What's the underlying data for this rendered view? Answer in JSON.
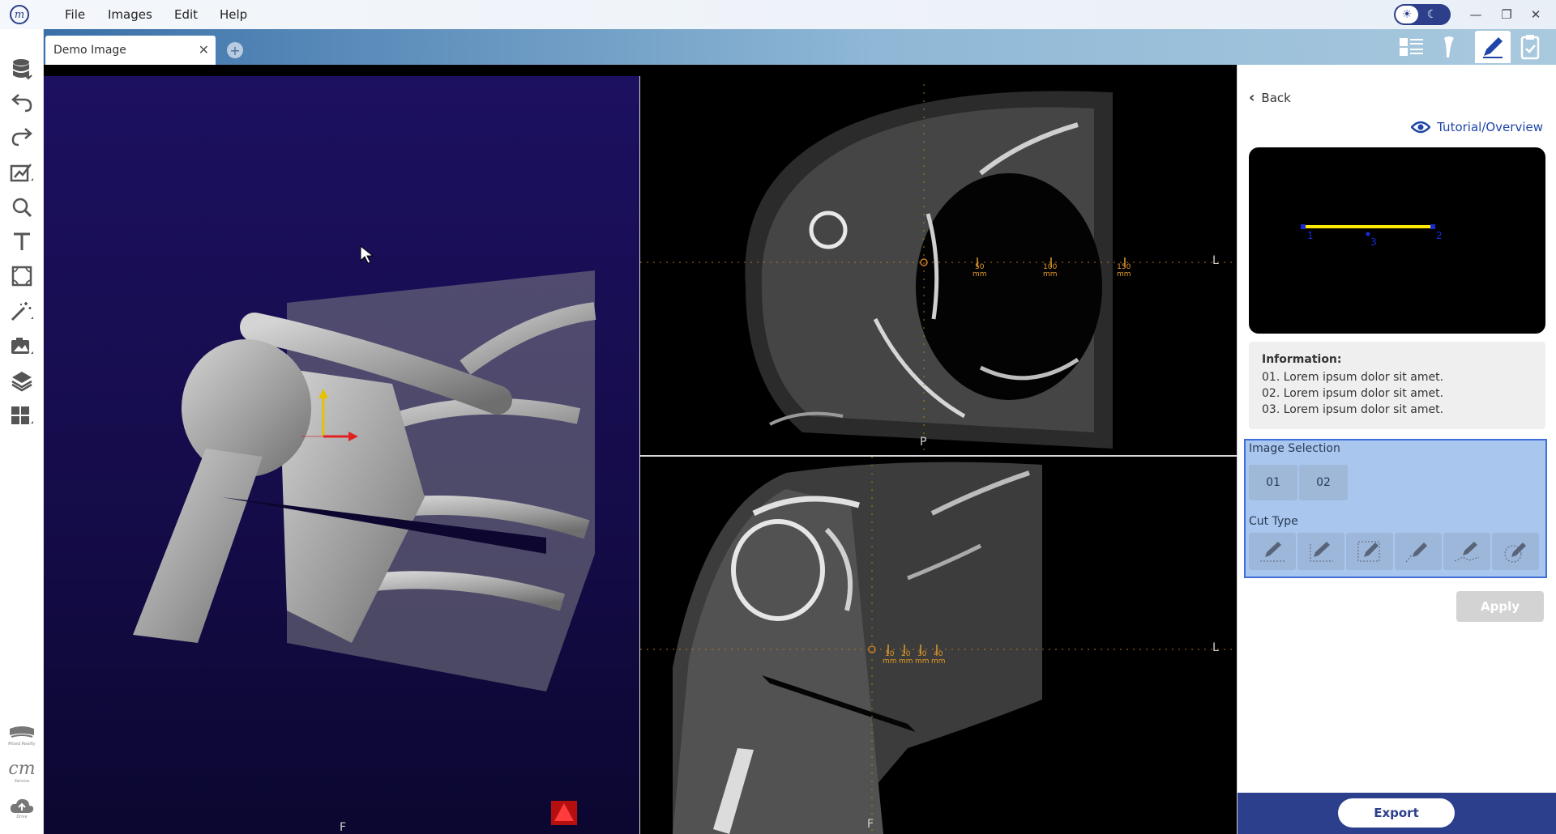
{
  "menu": {
    "file": "File",
    "images": "Images",
    "edit": "Edit",
    "help": "Help"
  },
  "theme": {
    "mode": "light"
  },
  "tabs": [
    {
      "label": "Demo Image",
      "close": "✕"
    }
  ],
  "tab_add": "+",
  "window_controls": {
    "minimize": "—",
    "restore": "❐",
    "close": "✕"
  },
  "sidebar": {
    "top_icons": [
      "database-icon",
      "undo-icon",
      "redo-icon",
      "annotate-icon",
      "zoom-icon",
      "text-icon",
      "frame-icon",
      "magic-wand-icon",
      "screenshot-icon",
      "layers-icon",
      "layout-icon"
    ],
    "bottom_items": [
      {
        "icon": "mixed-reality-icon",
        "label": "Mixed Reality"
      },
      {
        "icon": "service-icon",
        "label": "Service"
      },
      {
        "icon": "drive-icon",
        "label": "Drive"
      }
    ]
  },
  "viewports": {
    "threeD": {
      "orientation_bottom": "F"
    },
    "axial": {
      "orientation_right": "L",
      "orientation_bottom": "P",
      "scale_ticks": [
        "50",
        "100",
        "150"
      ],
      "scale_unit": "mm"
    },
    "coronal": {
      "orientation_right": "L",
      "orientation_bottom": "F",
      "scale_ticks": [
        "10",
        "20",
        "30",
        "40"
      ],
      "scale_unit": "mm"
    }
  },
  "panel": {
    "back_label": "Back",
    "tutorial_label": "Tutorial/Overview",
    "preview": {
      "point_labels": [
        "1",
        "3",
        "2"
      ]
    },
    "info": {
      "title": "Information:",
      "lines": [
        "01. Lorem ipsum dolor sit amet.",
        "02. Lorem ipsum dolor sit amet.",
        "03. Lorem ipsum dolor sit amet."
      ]
    },
    "image_selection": {
      "title": "Image Selection",
      "options": [
        "01",
        "02"
      ]
    },
    "cut_type": {
      "title": "Cut Type",
      "options": [
        "line-cut-icon",
        "corner-cut-icon",
        "box-cut-icon",
        "plane-cut-icon",
        "polyline-cut-icon",
        "freehand-cut-icon"
      ]
    },
    "apply_label": "Apply",
    "export_label": "Export"
  },
  "colors": {
    "brand": "#2c3f8c",
    "accent": "#1f45a8",
    "selection_bg": "#a8c6ee",
    "selection_border": "#3f6fd6",
    "preview_line": "#ffea00",
    "preview_points": "#1a2bd6"
  }
}
